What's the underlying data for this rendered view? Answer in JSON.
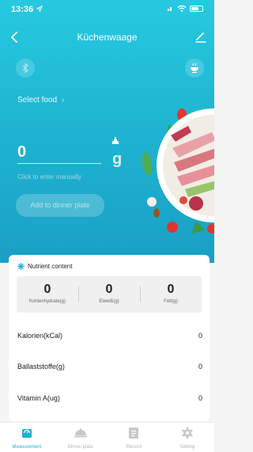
{
  "status": {
    "time": "13:36"
  },
  "nav": {
    "title": "Küchenwaage"
  },
  "hero": {
    "select_food": "Select food",
    "weight": "0",
    "unit": "g",
    "manual_hint": "Click to enter manually",
    "add_button": "Add to dinner plate"
  },
  "nutrients": {
    "title": "Nutrient content",
    "macros": [
      {
        "value": "0",
        "label": "Kohlenhydrate(g)"
      },
      {
        "value": "0",
        "label": "Eiweiß(g)"
      },
      {
        "value": "0",
        "label": "Fett(g)"
      }
    ],
    "rows": [
      {
        "label": "Kalorien(kCal)",
        "value": "0"
      },
      {
        "label": "Ballaststoffe(g)",
        "value": "0"
      },
      {
        "label": "Vitamin A(ug)",
        "value": "0"
      }
    ]
  },
  "tabs": [
    {
      "label": "Measurement",
      "icon": "scale-icon",
      "active": true
    },
    {
      "label": "Dinner plate",
      "icon": "plate-cover-icon",
      "active": false
    },
    {
      "label": "Record",
      "icon": "document-icon",
      "active": false
    },
    {
      "label": "Setting",
      "icon": "gear-icon",
      "active": false
    }
  ],
  "colors": {
    "accent": "#1fb0d0",
    "hero_top": "#27c9e1",
    "hero_bottom": "#1a9fc6"
  }
}
